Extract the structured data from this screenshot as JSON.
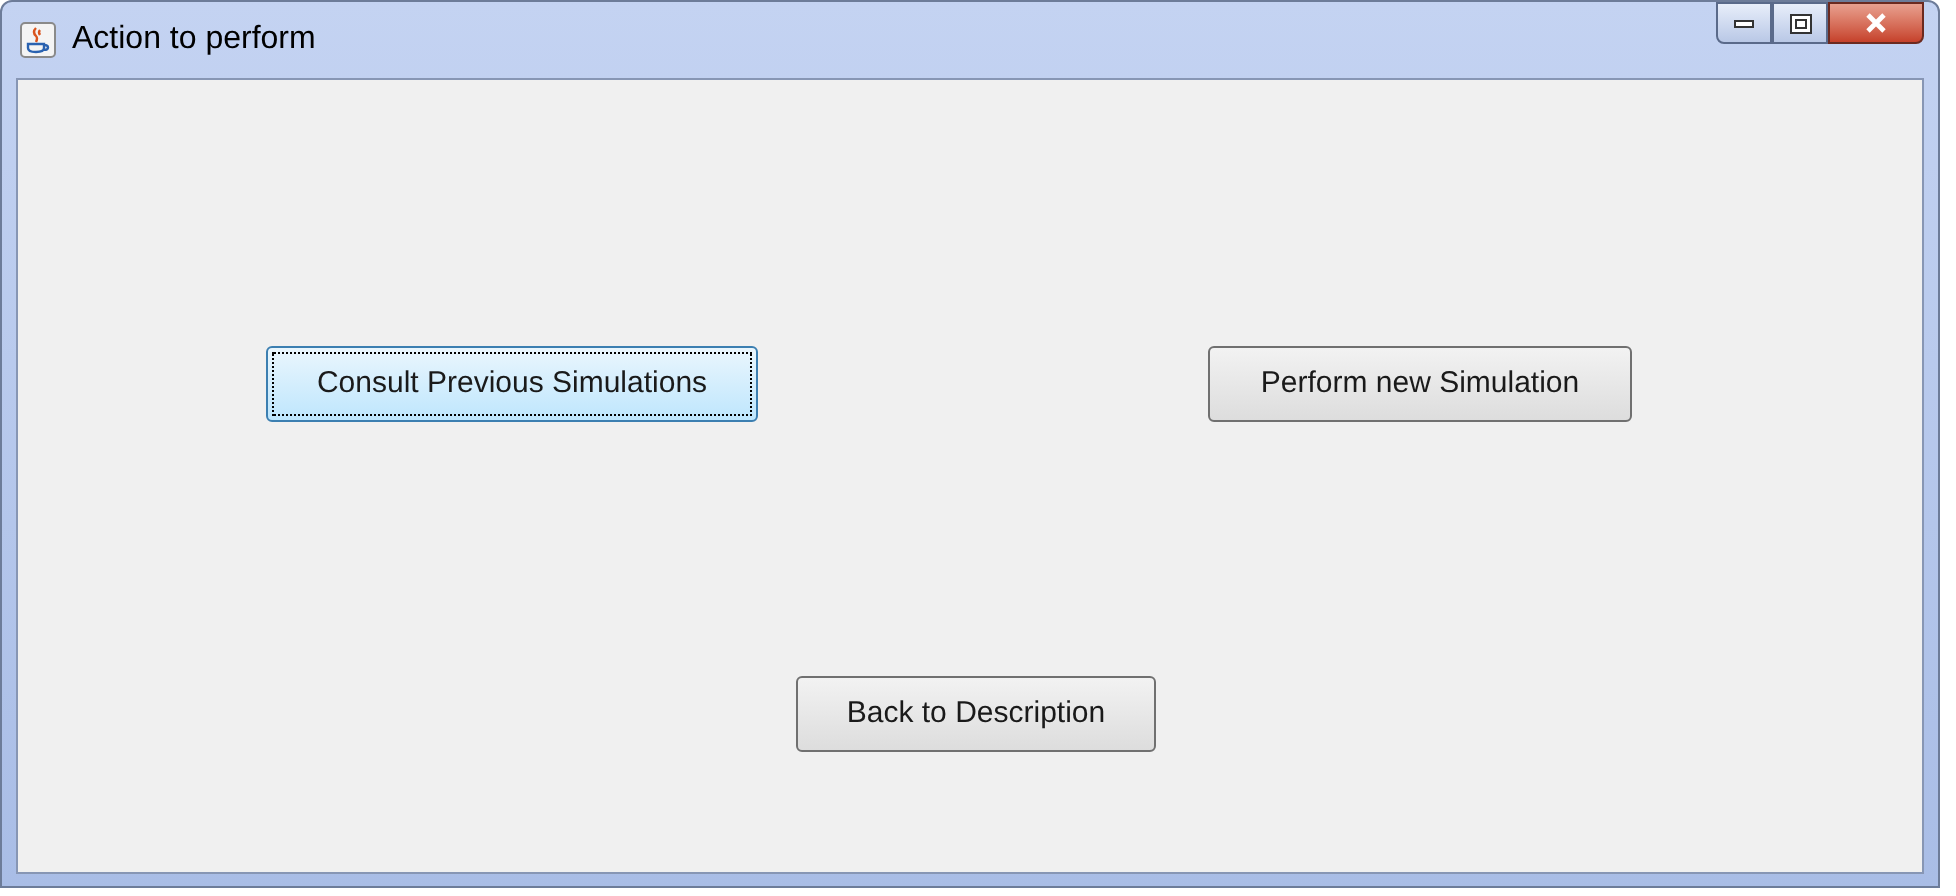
{
  "window": {
    "title": "Action to perform"
  },
  "buttons": [
    {
      "label": "Consult Previous Simulations",
      "focused": true
    },
    {
      "label": "Perform new Simulation",
      "focused": false
    },
    {
      "label": "Back to Description",
      "focused": false
    }
  ]
}
